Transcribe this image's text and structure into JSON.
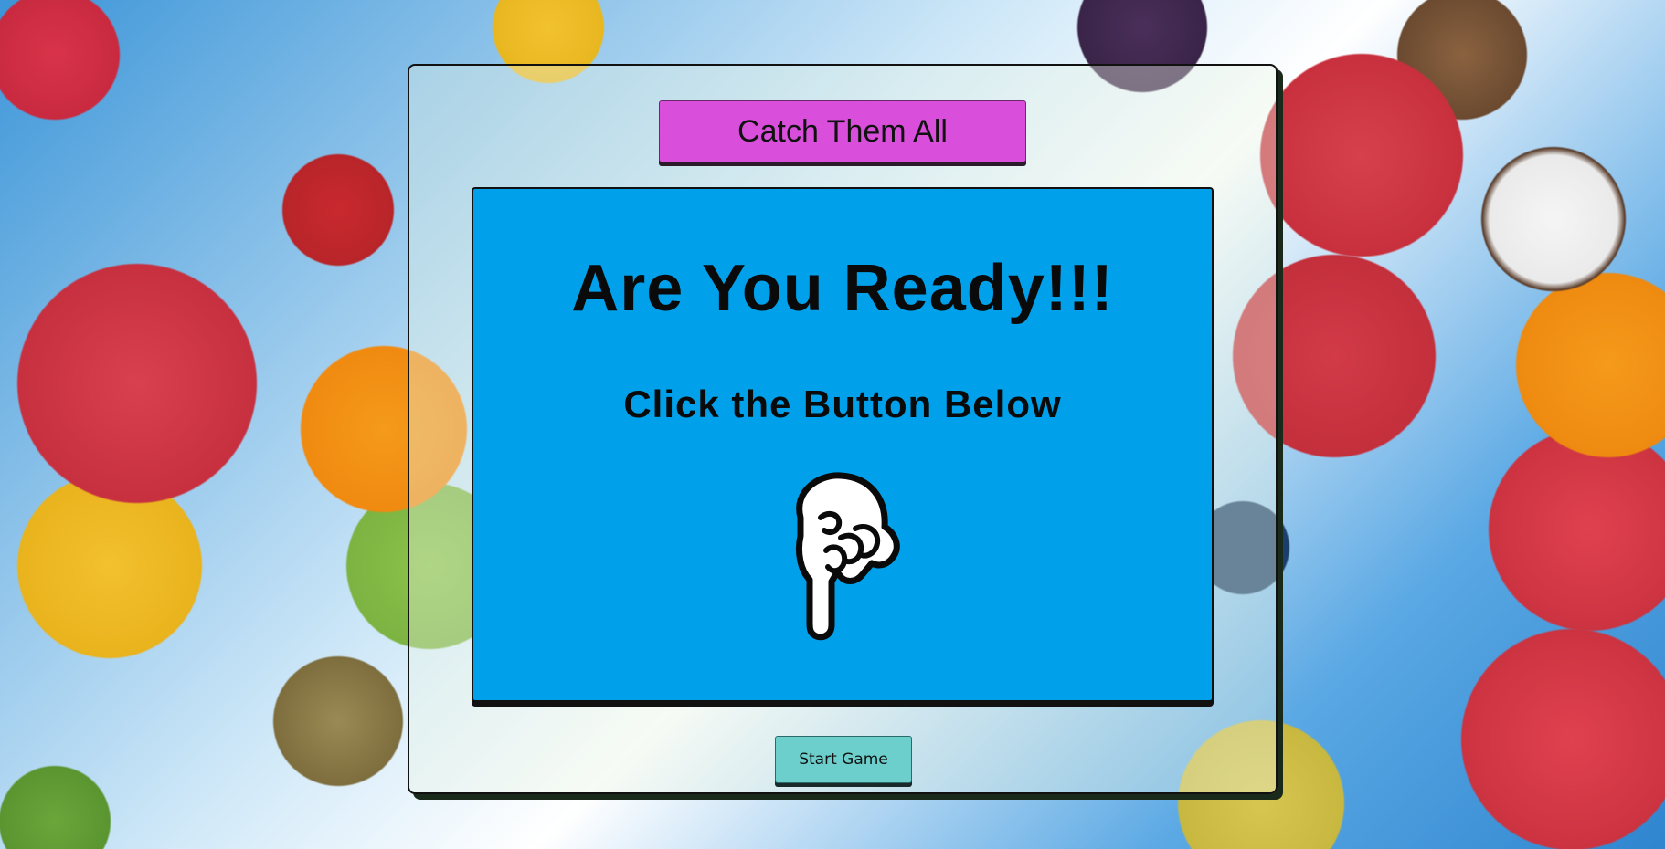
{
  "game": {
    "title": "Catch Them All",
    "headline": "Are You Ready!!!",
    "instruction": "Click the Button Below",
    "start_button_label": "Start Game",
    "pointer_icon": "pointing-down-hand-icon"
  },
  "colors": {
    "title_bar": "#d94fdb",
    "screen": "#00a0ea",
    "start_button": "#6ccfcb"
  }
}
